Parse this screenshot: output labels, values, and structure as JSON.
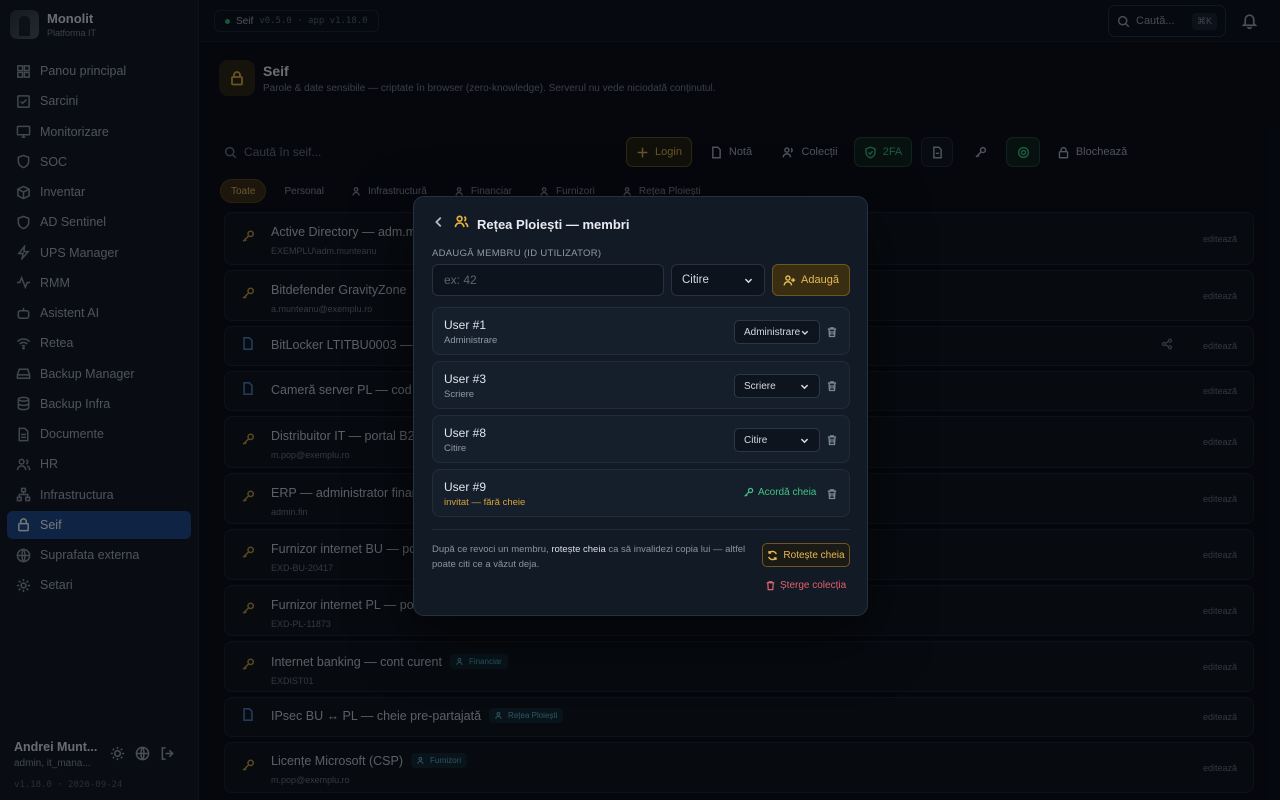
{
  "app": {
    "name": "Monolit",
    "subtitle": "Platforma IT"
  },
  "env": {
    "name": "Seif",
    "version": "v0.5.0 · app v1.18.0"
  },
  "header_search": {
    "label": "Caută...",
    "shortcut": "⌘K"
  },
  "sidebar": {
    "items": [
      {
        "label": "Panou principal",
        "icon": "dashboard-icon"
      },
      {
        "label": "Sarcini",
        "icon": "tasks-icon"
      },
      {
        "label": "Monitorizare",
        "icon": "monitor-icon"
      },
      {
        "label": "SOC",
        "icon": "shield-icon"
      },
      {
        "label": "Inventar",
        "icon": "box-icon"
      },
      {
        "label": "AD Sentinel",
        "icon": "shield-check-icon"
      },
      {
        "label": "UPS Manager",
        "icon": "bolt-icon"
      },
      {
        "label": "RMM",
        "icon": "activity-icon"
      },
      {
        "label": "Asistent AI",
        "icon": "bot-icon"
      },
      {
        "label": "Retea",
        "icon": "wifi-icon"
      },
      {
        "label": "Backup Manager",
        "icon": "hdd-icon"
      },
      {
        "label": "Backup Infra",
        "icon": "database-icon"
      },
      {
        "label": "Documente",
        "icon": "document-icon"
      },
      {
        "label": "HR",
        "icon": "users-icon"
      },
      {
        "label": "Infrastructura",
        "icon": "network-icon"
      },
      {
        "label": "Seif",
        "icon": "lock-icon",
        "active": true
      },
      {
        "label": "Suprafata externa",
        "icon": "globe-icon"
      },
      {
        "label": "Setari",
        "icon": "gear-icon"
      }
    ]
  },
  "user": {
    "name": "Andrei Munt...",
    "role": "admin, it_mana...",
    "version": "v1.18.0 · 2026-09-24"
  },
  "page": {
    "title": "Seif",
    "subtitle": "Parole & date sensibile — criptate în browser (zero-knowledge). Serverul nu vede niciodată conținutul."
  },
  "vault_search": {
    "placeholder": "Caută în seif..."
  },
  "toolbar": {
    "login": "Login",
    "note": "Notă",
    "collections": "Colecții",
    "twofa": "2FA",
    "lock": "Blochează"
  },
  "filters": [
    {
      "label": "Toate",
      "active": true
    },
    {
      "label": "Personal"
    },
    {
      "label": "Infrastructură",
      "icon": true
    },
    {
      "label": "Financiar",
      "icon": true
    },
    {
      "label": "Furnizori",
      "icon": true
    },
    {
      "label": "Rețea Ploiești",
      "icon": true
    }
  ],
  "rows": [
    {
      "title": "Active Directory — adm.m",
      "sub": "EXEMPLU\\adm.munteanu",
      "type": "login",
      "edit": "editează"
    },
    {
      "title": "Bitdefender GravityZone",
      "sub": "a.munteanu@exemplu.ro",
      "type": "login",
      "edit": "editează"
    },
    {
      "title": "BitLocker LTITBU0003 — c",
      "sub": "",
      "type": "note",
      "edit": "editează",
      "share": true
    },
    {
      "title": "Cameră server PL — cod a",
      "sub": "",
      "type": "note",
      "edit": "editează"
    },
    {
      "title": "Distribuitor IT — portal B2",
      "sub": "m.pop@exemplu.ro",
      "type": "login",
      "edit": "editează"
    },
    {
      "title": "ERP — administrator finar",
      "sub": "admin.fin",
      "type": "login",
      "edit": "editează"
    },
    {
      "title": "Furnizor internet BU — po",
      "sub": "EXD-BU-20417",
      "type": "login",
      "edit": "editează"
    },
    {
      "title": "Furnizor internet PL — po",
      "sub": "EXD-PL-11873",
      "type": "login",
      "edit": "editează"
    },
    {
      "title": "Internet banking — cont curent",
      "sub": "EXDIST01",
      "type": "login",
      "tag": "Financiar",
      "edit": "editează"
    },
    {
      "title": "IPsec BU ↔ PL — cheie pre-partajată",
      "sub": "",
      "type": "note",
      "tag": "Rețea Ploiești",
      "edit": "editează"
    },
    {
      "title": "Licențe Microsoft (CSP)",
      "sub": "m.pop@exemplu.ro",
      "type": "login",
      "tag": "Furnizori",
      "edit": "editează"
    }
  ],
  "modal": {
    "title": "Rețea Ploiești — membri",
    "add_label": "ADAUGĂ MEMBRU (ID UTILIZATOR)",
    "input_placeholder": "ex: 42",
    "role_select": "Citire",
    "add_button": "Adaugă",
    "members": [
      {
        "name": "User #1",
        "role": "Administrare",
        "select": "Administrare"
      },
      {
        "name": "User #3",
        "role": "Scriere",
        "select": "Scriere"
      },
      {
        "name": "User #8",
        "role": "Citire",
        "select": "Citire"
      },
      {
        "name": "User #9",
        "role": "invitat — fără cheie",
        "grant": "Acordă cheia",
        "invited": true
      }
    ],
    "note_pre": "După ce revoci un membru, ",
    "note_strong": "rotește cheia",
    "note_post": " ca să invalidezi copia lui — altfel poate citi ce a văzut deja.",
    "rotate_button": "Rotește cheia",
    "delete_collection": "Șterge colecția"
  },
  "colors": {
    "accent_gold": "#e5b954",
    "active_nav": "#1e4a8e",
    "danger": "#e0616a",
    "success": "#3fc483"
  }
}
